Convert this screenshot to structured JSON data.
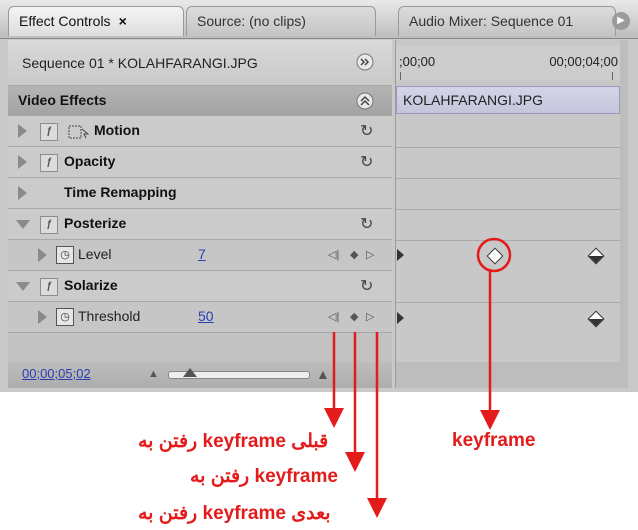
{
  "tabs": [
    {
      "label": "Effect Controls",
      "close": "×",
      "active": true
    },
    {
      "label": "Source: (no clips)",
      "active": false
    },
    {
      "label": "Audio Mixer: Sequence 01",
      "active": false
    }
  ],
  "sequence_label": "Sequence 01 * KOLAHFARANGI.JPG",
  "section_title": "Video Effects",
  "effects": [
    {
      "name": "Motion",
      "expanded": false
    },
    {
      "name": "Opacity",
      "expanded": false
    },
    {
      "name": "Time Remapping",
      "expanded": false
    },
    {
      "name": "Posterize",
      "expanded": true,
      "param": {
        "name": "Level",
        "value": "7"
      }
    },
    {
      "name": "Solarize",
      "expanded": true,
      "param": {
        "name": "Threshold",
        "value": "50"
      }
    }
  ],
  "timeline": {
    "start": ";00;00",
    "end": "00;00;04;00",
    "clip_name": "KOLAHFARANGI.JPG"
  },
  "current_timecode": "00;00;05;02",
  "annotations": {
    "keyframe": "keyframe",
    "prev_keyframe": "رفتن به keyframe قبلی",
    "add_keyframe": "رفتن به keyframe",
    "next_keyframe": "رفتن به keyframe بعدی"
  },
  "colors": {
    "annotation": "#e31b1b",
    "link": "#2a3fb0"
  }
}
